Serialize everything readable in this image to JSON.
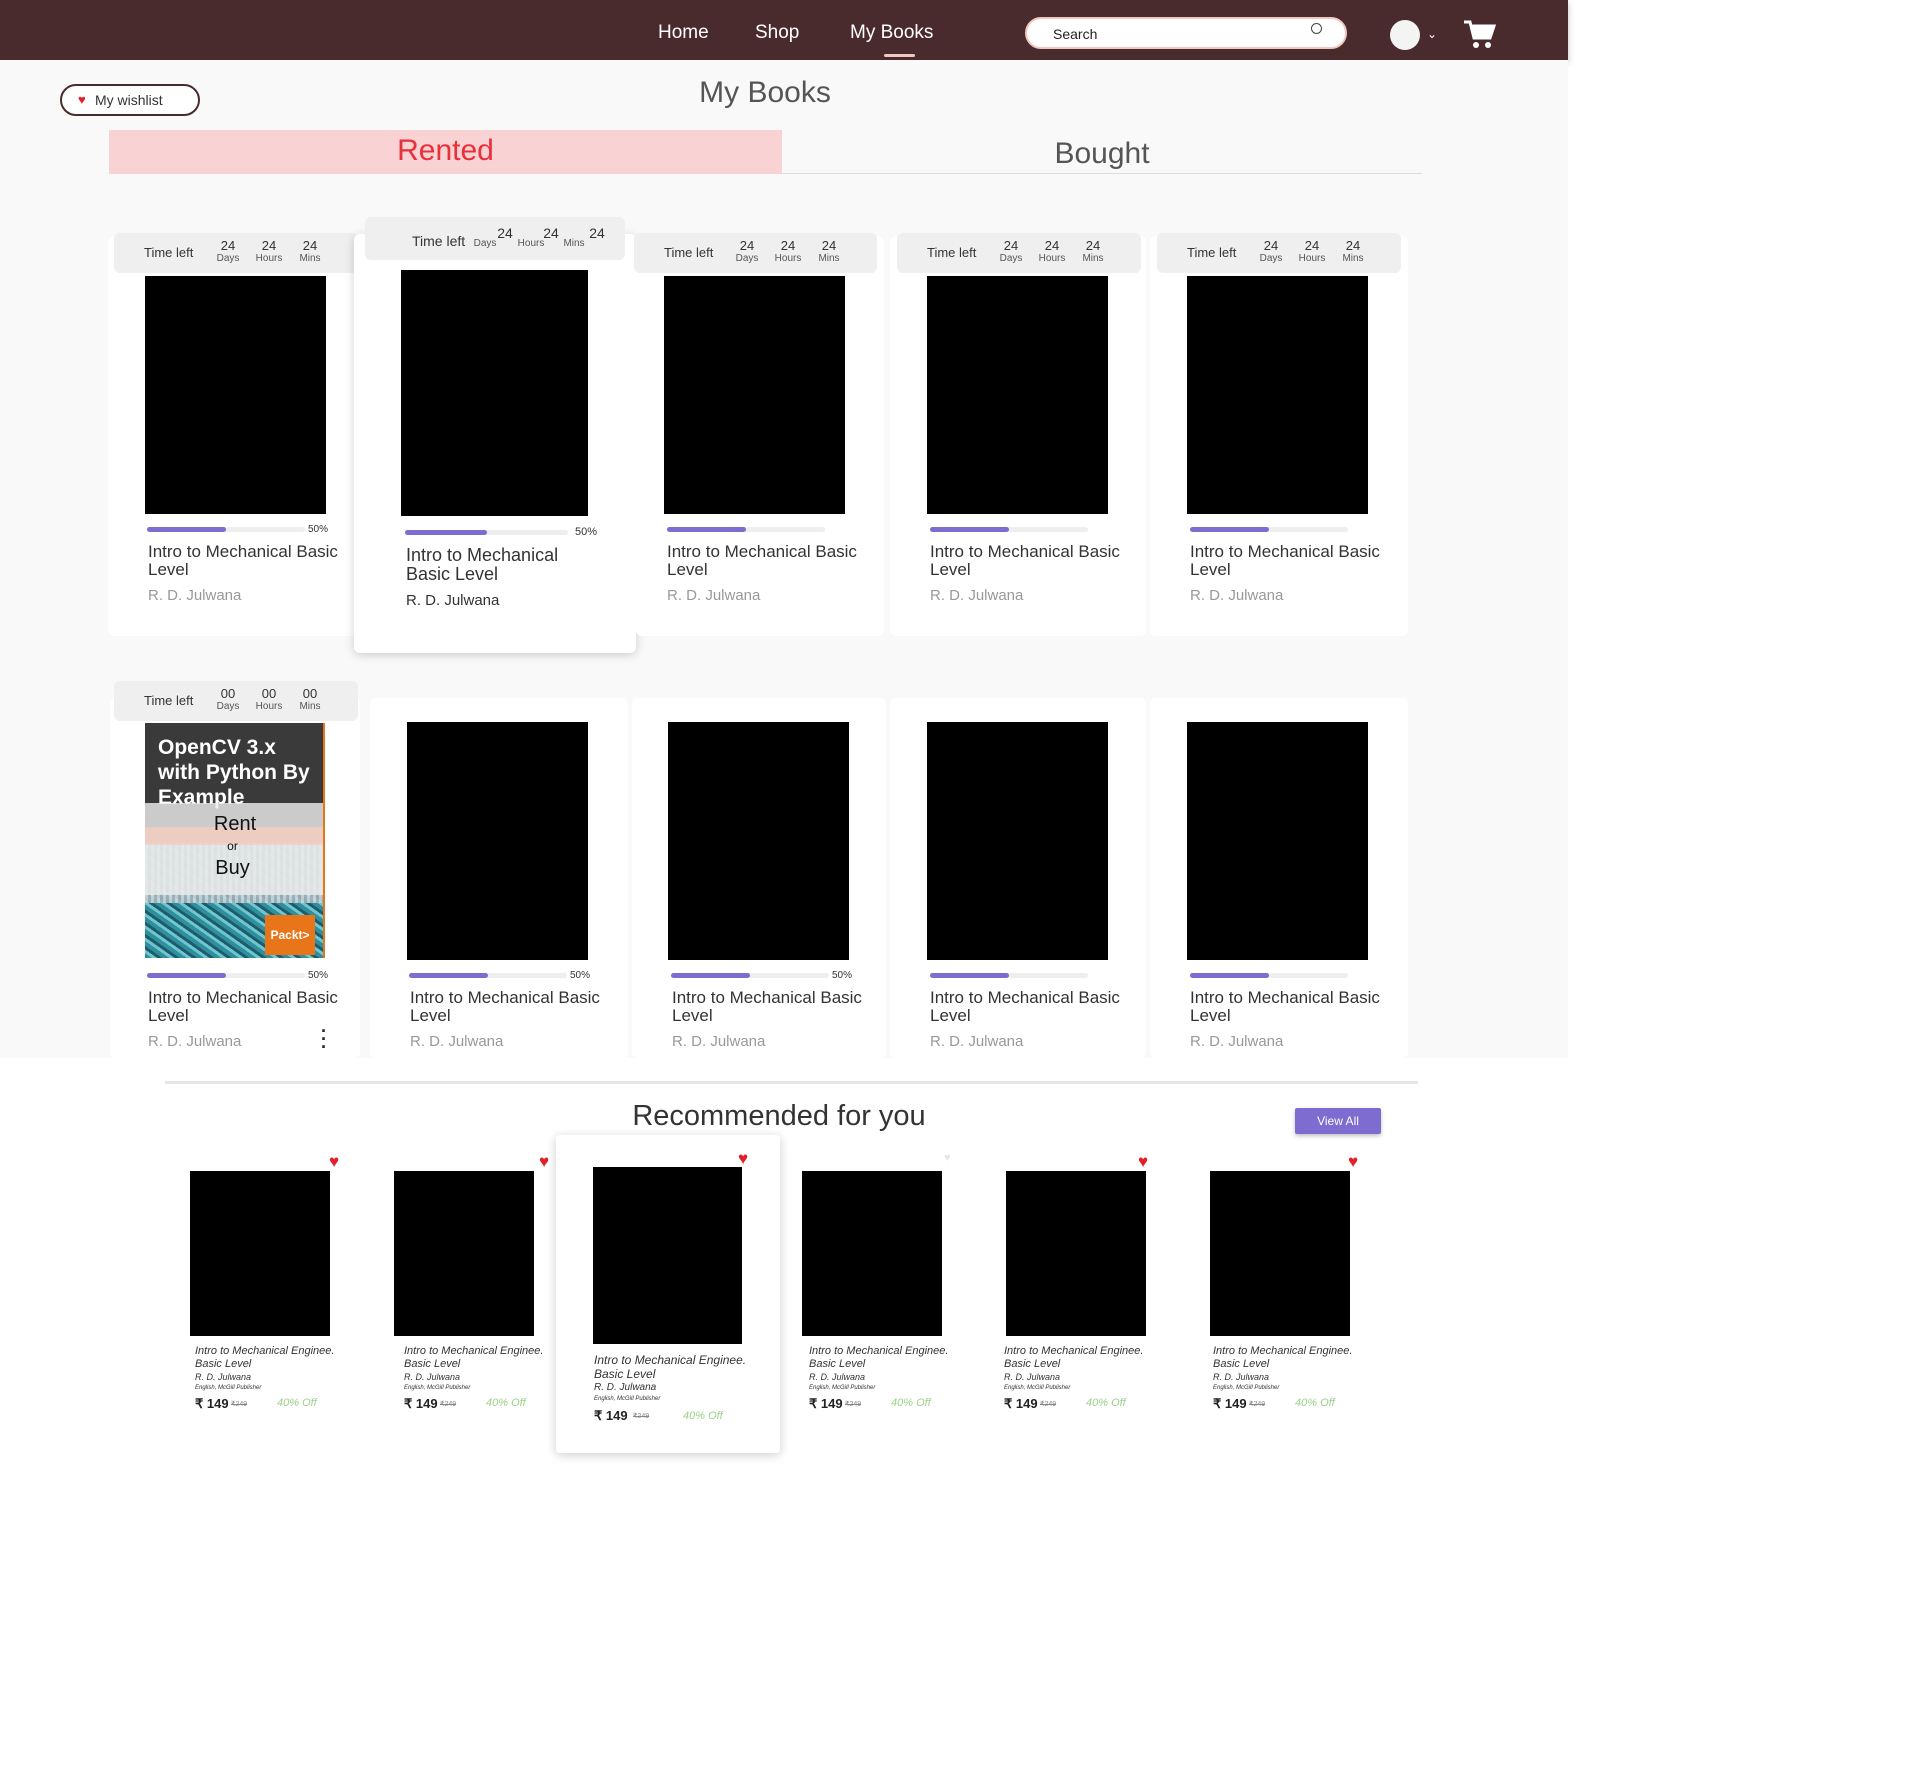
{
  "nav": {
    "links": [
      "Home",
      "Shop",
      "My Books"
    ],
    "search_placeholder": "Search",
    "colors": {
      "bar": "#4a2b2d",
      "accent": "#f2c7c1"
    }
  },
  "page": {
    "wishlist_label": "My wishlist",
    "title": "My Books",
    "tabs": [
      "Rented",
      "Bought"
    ]
  },
  "rented": {
    "time_left_label": "Time left",
    "unit_labels": [
      "Days",
      "Hours",
      "Mins"
    ],
    "row1": [
      {
        "days": "24",
        "hours": "24",
        "mins": "24",
        "progress": 0.5,
        "pct": "50%",
        "title": "Intro to Mechanical Basic Level",
        "author": "R. D. Julwana"
      },
      {
        "days": "24",
        "hours": "24",
        "mins": "24",
        "progress": 0.5,
        "pct": "50%",
        "title": "Intro to Mechanical Basic Level",
        "author": "R. D. Julwana"
      },
      {
        "days": "24",
        "hours": "24",
        "mins": "24",
        "progress": 0.5,
        "pct": "",
        "title": "Intro to Mechanical Basic Level",
        "author": "R. D. Julwana"
      },
      {
        "days": "24",
        "hours": "24",
        "mins": "24",
        "progress": 0.5,
        "pct": "",
        "title": "Intro to Mechanical Basic Level",
        "author": "R. D. Julwana"
      },
      {
        "days": "24",
        "hours": "24",
        "mins": "24",
        "progress": 0.5,
        "pct": "",
        "title": "Intro to Mechanical Basic Level",
        "author": "R. D. Julwana"
      }
    ],
    "row2": [
      {
        "days": "00",
        "hours": "00",
        "mins": "00",
        "progress": 0.5,
        "pct": "50%",
        "title": "Intro to Mechanical Basic Level",
        "author": "R. D. Julwana"
      },
      {
        "progress": 0.5,
        "pct": "50%",
        "title": "Intro to Mechanical Basic Level",
        "author": "R. D. Julwana"
      },
      {
        "progress": 0.5,
        "pct": "50%",
        "title": "Intro to Mechanical Basic Level",
        "author": "R. D. Julwana"
      },
      {
        "progress": 0.5,
        "pct": "",
        "title": "Intro to Mechanical Basic Level",
        "author": "R. D. Julwana"
      },
      {
        "progress": 0.5,
        "pct": "",
        "title": "Intro to Mechanical Basic Level",
        "author": "R. D. Julwana"
      }
    ],
    "featured_cover": {
      "title": "OpenCV 3.x with Python By Example",
      "publisher": "Packt>",
      "overlay_rent": "Rent",
      "overlay_or": "or",
      "overlay_buy": "Buy"
    }
  },
  "recommended": {
    "title": "Recommended for you",
    "view_all_label": "View All",
    "items": [
      {
        "title": "Intro to Mechanical Enginee. Basic Level",
        "author": "R. D. Julwana",
        "publisher": "English, McGill Publisher",
        "price": "₹ 149",
        "old_price": "₹249",
        "discount": "40% Off",
        "wishlisted": true
      },
      {
        "title": "Intro to Mechanical Enginee. Basic Level",
        "author": "R. D. Julwana",
        "publisher": "English, McGill Publisher",
        "price": "₹ 149",
        "old_price": "₹249",
        "discount": "40% Off",
        "wishlisted": true
      },
      {
        "title": "Intro to Mechanical Enginee. Basic Level",
        "author": "R. D. Julwana",
        "publisher": "English, McGill Publisher",
        "price": "₹ 149",
        "old_price": "₹249",
        "discount": "40% Off",
        "wishlisted": true
      },
      {
        "title": "Intro to Mechanical Enginee. Basic Level",
        "author": "R. D. Julwana",
        "publisher": "English, McGill Publisher",
        "price": "₹ 149",
        "old_price": "₹249",
        "discount": "40% Off",
        "wishlisted": false
      },
      {
        "title": "Intro to Mechanical Enginee. Basic Level",
        "author": "R. D. Julwana",
        "publisher": "English, McGill Publisher",
        "price": "₹ 149",
        "old_price": "₹249",
        "discount": "40% Off",
        "wishlisted": true
      },
      {
        "title": "Intro to Mechanical Enginee. Basic Level",
        "author": "R. D. Julwana",
        "publisher": "English, McGill Publisher",
        "price": "₹ 149",
        "old_price": "₹249",
        "discount": "40% Off",
        "wishlisted": true
      }
    ]
  }
}
